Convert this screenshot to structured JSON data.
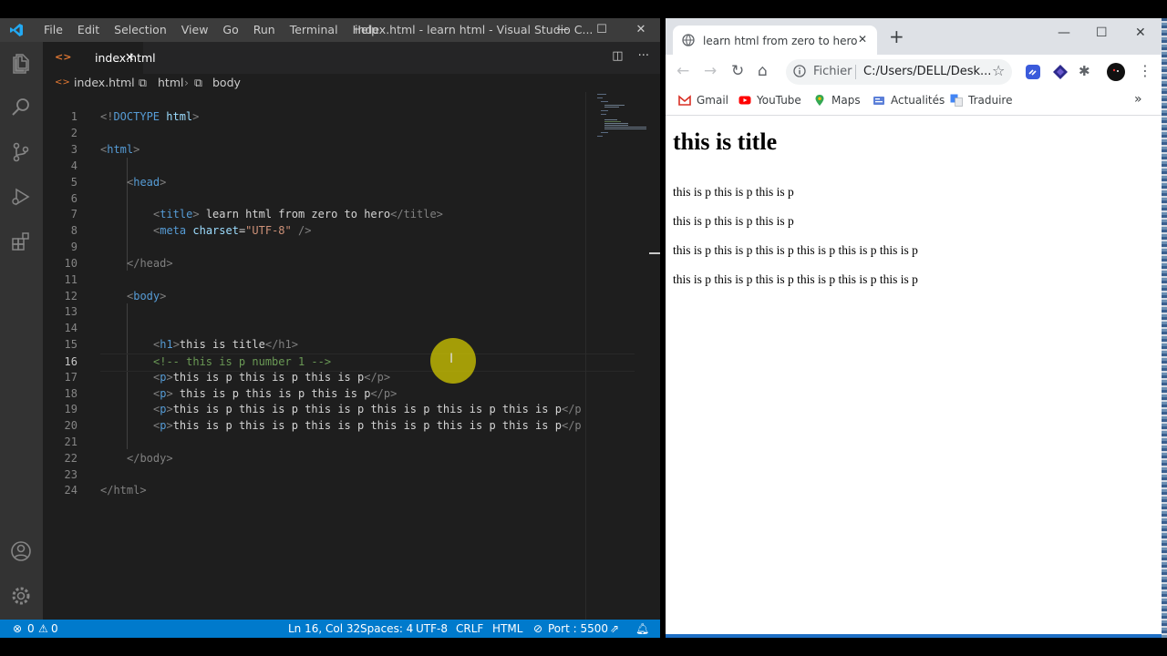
{
  "vscode": {
    "menu": [
      "File",
      "Edit",
      "Selection",
      "View",
      "Go",
      "Run",
      "Terminal",
      "Help"
    ],
    "window_title": "index.html - learn html - Visual Studio C...",
    "tab": {
      "name": "index.html",
      "close": "✕"
    },
    "breadcrumb": {
      "file": "index.html",
      "html": "html",
      "body": "body"
    },
    "lines": [
      {
        "n": "1"
      },
      {
        "n": "2"
      },
      {
        "n": "3"
      },
      {
        "n": "4"
      },
      {
        "n": "5"
      },
      {
        "n": "6"
      },
      {
        "n": "7"
      },
      {
        "n": "8"
      },
      {
        "n": "9"
      },
      {
        "n": "10"
      },
      {
        "n": "11"
      },
      {
        "n": "12"
      },
      {
        "n": "13"
      },
      {
        "n": "14"
      },
      {
        "n": "15"
      },
      {
        "n": "16"
      },
      {
        "n": "17"
      },
      {
        "n": "18"
      },
      {
        "n": "19"
      },
      {
        "n": "20"
      },
      {
        "n": "21"
      },
      {
        "n": "22"
      },
      {
        "n": "23"
      },
      {
        "n": "24"
      }
    ],
    "code": {
      "l1_open": "<!",
      "l1_tag": "DOCTYPE",
      "l1_attr": " html",
      "l1_close": ">",
      "html_tag": "html",
      "head_tag": "head",
      "title_tag": "title",
      "title_text": " learn html from zero to hero",
      "title_close": "</title>",
      "meta_tag": "meta",
      "meta_attr": " charset",
      "meta_eq": "=",
      "meta_val": "\"UTF-8\"",
      "meta_end": " />",
      "head_close": "</head>",
      "body_tag": "body",
      "h1_tag": "h1",
      "h1_text": "this is title",
      "h1_close": "</h1>",
      "comment": "<!-- this is p number 1 -->",
      "p_tag": "p",
      "p17_text": "this is p this is p this is p",
      "p18_text": " this is p this is p this is p",
      "p19_text": "this is p this is p this is p this is p this is p this is p",
      "p20_text": "this is p this is p this is p this is p this is p this is p",
      "p_close": "</p>",
      "p_close_cut": "</p",
      "body_close": "</body>",
      "html_close": "</html>"
    },
    "status": {
      "errors": "0",
      "warnings": "0",
      "position": "Ln 16, Col 32",
      "spaces": "Spaces: 4",
      "encoding": "UTF-8",
      "eol": "CRLF",
      "language": "HTML",
      "port": "Port : 5500"
    },
    "icons": [
      "vscode-logo-icon",
      "explorer-icon",
      "search-icon",
      "source-control-icon",
      "run-debug-icon",
      "extensions-icon",
      "account-icon",
      "settings-gear-icon"
    ]
  },
  "browser": {
    "tab_title": "learn html from zero to hero",
    "address_label": "Fichier",
    "url": "C:/Users/DELL/Desk...",
    "bookmarks": [
      "Gmail",
      "YouTube",
      "Maps",
      "Actualités",
      "Traduire"
    ],
    "page": {
      "h1": "this is title",
      "paragraphs": [
        "this is p this is p this is p",
        "this is p this is p this is p",
        "this is p this is p this is p this is p this is p this is p",
        "this is p this is p this is p this is p this is p this is p"
      ]
    }
  }
}
